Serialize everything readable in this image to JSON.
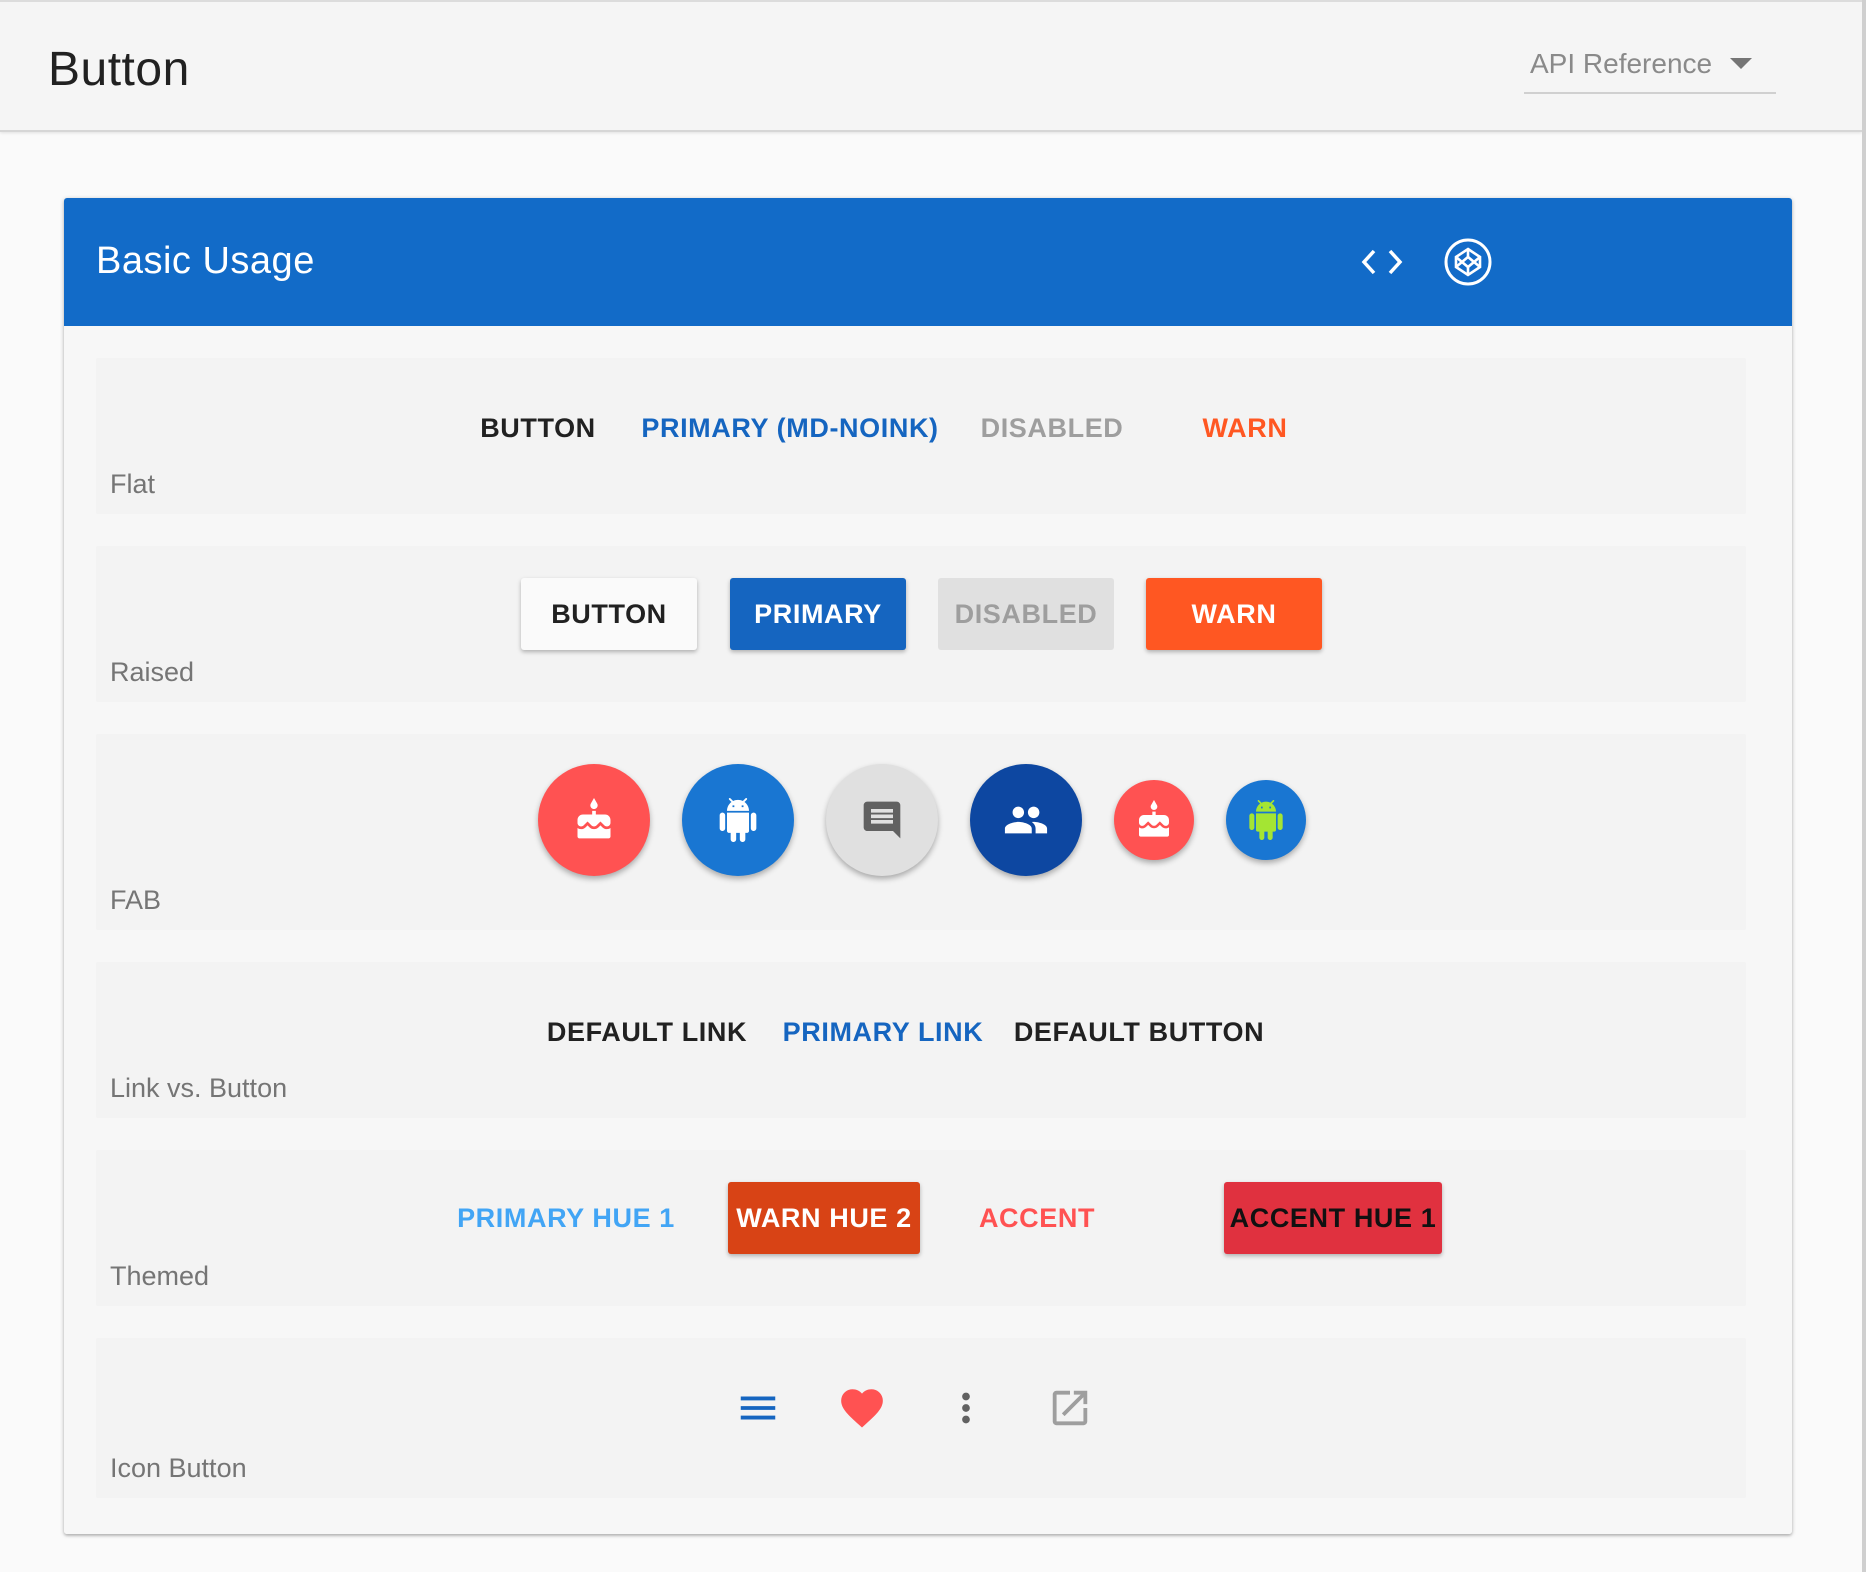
{
  "toolbar": {
    "title": "Button",
    "api_select": {
      "value": "API Reference"
    }
  },
  "card": {
    "title": "Basic Usage",
    "actions": [
      {
        "icon": "code-icon"
      },
      {
        "icon": "codepen-icon"
      }
    ]
  },
  "sections": {
    "flat": {
      "label": "Flat",
      "buttons": [
        "Button",
        "Primary (md-noink)",
        "Disabled",
        "Warn"
      ]
    },
    "raised": {
      "label": "Raised",
      "buttons": [
        "Button",
        "Primary",
        "Disabled",
        "Warn"
      ]
    },
    "fab": {
      "label": "FAB",
      "buttons": [
        {
          "icon": "cake-icon",
          "color": "#ff5252"
        },
        {
          "icon": "android-icon",
          "color": "#1976d2"
        },
        {
          "icon": "message-icon",
          "color": "#e0e0e0"
        },
        {
          "icon": "people-icon",
          "color": "#0d47a1"
        },
        {
          "icon": "cake-icon",
          "color": "#ff5252"
        },
        {
          "icon": "android-icon",
          "color": "#1976d2"
        }
      ]
    },
    "links": {
      "label": "Link vs. Button",
      "buttons": [
        "Default Link",
        "Primary Link",
        "Default Button"
      ]
    },
    "themed": {
      "label": "Themed",
      "buttons": [
        "Primary Hue 1",
        "Warn Hue 2",
        "Accent",
        "Accent Hue 1"
      ]
    },
    "icons": {
      "label": "Icon Button",
      "buttons": [
        {
          "icon": "menu-icon"
        },
        {
          "icon": "heart-icon"
        },
        {
          "icon": "more-vert-icon"
        },
        {
          "icon": "open-in-new-icon"
        }
      ]
    }
  },
  "colors": {
    "primary": "#1565c0",
    "warn": "#ff5722",
    "accent": "#ff5252",
    "header": "#126bc8"
  }
}
